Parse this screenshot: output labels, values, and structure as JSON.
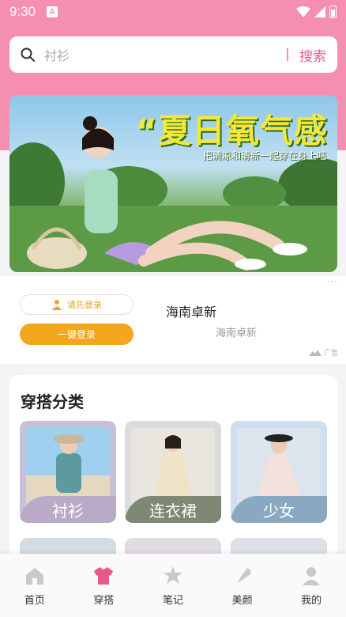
{
  "status_bar": {
    "time": "9:30",
    "app_icon": "A"
  },
  "search": {
    "placeholder": "衬衫",
    "button_label": "搜索"
  },
  "banner": {
    "title": "“夏日氧气感",
    "subtitle": "把清凉和清新一起穿在身上吧"
  },
  "ad": {
    "menu_dots": "···",
    "login_hint": "请先登录",
    "one_key_login": "一键登录",
    "title": "海南卓新",
    "subtitle": "海南卓新",
    "ad_tag": "广告"
  },
  "category": {
    "title": "穿搭分类",
    "tiles": [
      {
        "label": "衬衫"
      },
      {
        "label": "连衣裙"
      },
      {
        "label": "少女"
      }
    ]
  },
  "nav": {
    "items": [
      {
        "label": "首页",
        "icon": "home-icon"
      },
      {
        "label": "穿搭",
        "icon": "clothing-icon"
      },
      {
        "label": "笔记",
        "icon": "notes-icon"
      },
      {
        "label": "美颜",
        "icon": "beauty-icon"
      },
      {
        "label": "我的",
        "icon": "profile-icon"
      }
    ],
    "active_index": 1,
    "active_color": "#e8588c",
    "inactive_color": "#c9c9c9"
  },
  "colors": {
    "brand_pink": "#f58fb2",
    "accent_orange": "#f2a71c"
  }
}
